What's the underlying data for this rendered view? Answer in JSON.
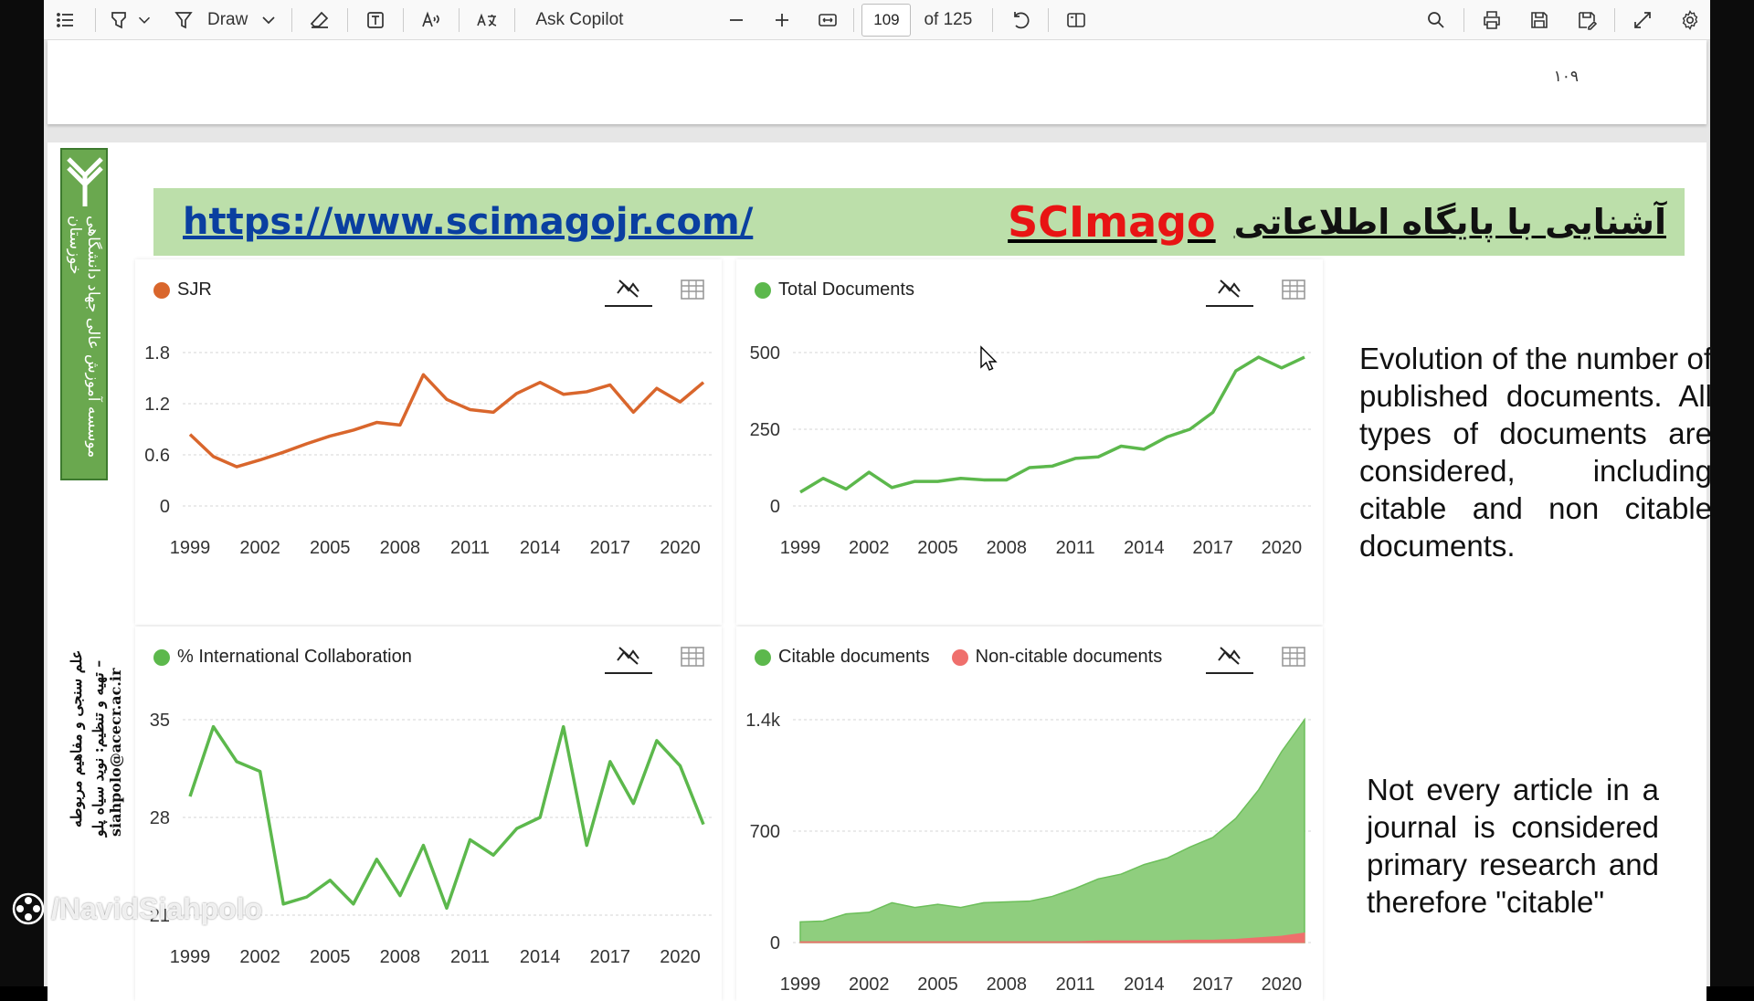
{
  "toolbar": {
    "draw_label": "Draw",
    "copilot_label": "Ask Copilot",
    "page_current": "109",
    "page_total": "of 125"
  },
  "prev_page": {
    "page_number": "۱۰۹"
  },
  "slide": {
    "banner": {
      "url": "https://www.scimagojr.com/",
      "brand": "SCImago",
      "persian_title": "آشنایی با پایگاه اطلاعاتی"
    },
    "side_strip_text": "موسسه آموزش عالی جهاد دانشگاهی خوزستان",
    "side_text_1": "علم سنجی و مفاهیم مربوطه",
    "side_text_2": "تهیه و تنظیم: نوید سیاه پلو – siahpolo@acecr.ac.ir",
    "desc_1": "Evolution of the number of published documents. All types of documents are considered, including citable and non citable documents.",
    "desc_2": "Not every article in a journal is considered primary research and therefore \"citable\""
  },
  "watermark": "/NavidSiahpolo",
  "icons": [
    "list-icon",
    "highlighter-icon",
    "draw-icon",
    "eraser-icon",
    "text-box-icon",
    "read-aloud-icon",
    "translate-icon",
    "zoom-out-icon",
    "zoom-in-icon",
    "fit-page-icon",
    "rotate-icon",
    "page-view-icon",
    "search-icon",
    "print-icon",
    "save-icon",
    "save-as-icon",
    "fullscreen-icon",
    "settings-icon"
  ],
  "colors": {
    "sjr": "#d9662c",
    "green": "#5cb84c",
    "area_green": "#8fce7e",
    "noncitable": "#ef6f6c",
    "banner_bg": "#bcdfaa",
    "brand_red": "#e81414"
  },
  "chart_data": [
    {
      "type": "line",
      "title": "SJR",
      "x": [
        1999,
        2000,
        2001,
        2002,
        2003,
        2004,
        2005,
        2006,
        2007,
        2008,
        2009,
        2010,
        2011,
        2012,
        2013,
        2014,
        2015,
        2016,
        2017,
        2018,
        2019,
        2020,
        2021
      ],
      "series": [
        {
          "name": "SJR",
          "values": [
            0.84,
            0.58,
            0.46,
            0.54,
            0.63,
            0.73,
            0.82,
            0.89,
            0.98,
            0.95,
            1.54,
            1.25,
            1.13,
            1.1,
            1.32,
            1.45,
            1.31,
            1.34,
            1.42,
            1.1,
            1.38,
            1.22,
            1.45,
            1.43
          ]
        }
      ],
      "yticks": [
        "0",
        "0.6",
        "1.2",
        "1.8"
      ],
      "ylim": [
        0,
        1.8
      ],
      "xticks": [
        "1999",
        "2002",
        "2005",
        "2008",
        "2011",
        "2014",
        "2017",
        "2020"
      ],
      "grid": true
    },
    {
      "type": "line",
      "title": "Total Documents",
      "x": [
        1999,
        2000,
        2001,
        2002,
        2003,
        2004,
        2005,
        2006,
        2007,
        2008,
        2009,
        2010,
        2011,
        2012,
        2013,
        2014,
        2015,
        2016,
        2017,
        2018,
        2019,
        2020,
        2021
      ],
      "series": [
        {
          "name": "Total Documents",
          "values": [
            45,
            90,
            55,
            110,
            60,
            80,
            80,
            90,
            85,
            85,
            125,
            130,
            155,
            160,
            195,
            185,
            225,
            250,
            305,
            440,
            485,
            450,
            485
          ]
        }
      ],
      "yticks": [
        "0",
        "250",
        "500"
      ],
      "ylim": [
        0,
        500
      ],
      "xticks": [
        "1999",
        "2002",
        "2005",
        "2008",
        "2011",
        "2014",
        "2017",
        "2020"
      ],
      "grid": true
    },
    {
      "type": "line",
      "title": "% International Collaboration",
      "x": [
        1999,
        2000,
        2001,
        2002,
        2003,
        2004,
        2005,
        2006,
        2007,
        2008,
        2009,
        2010,
        2011,
        2012,
        2013,
        2014,
        2015,
        2016,
        2017,
        2018,
        2019,
        2020,
        2021
      ],
      "series": [
        {
          "name": "% International Collaboration",
          "values": [
            29.5,
            34.5,
            32,
            31.3,
            21.8,
            22.3,
            23.5,
            21.8,
            25,
            22.4,
            26,
            21.5,
            26.4,
            25.3,
            27.2,
            28,
            34.5,
            26,
            32,
            29,
            33.5,
            31.7,
            27.5
          ]
        }
      ],
      "yticks": [
        "21",
        "28",
        "35"
      ],
      "ylim": [
        21,
        35
      ],
      "xticks": [
        "1999",
        "2002",
        "2005",
        "2008",
        "2011",
        "2014",
        "2017",
        "2020"
      ],
      "grid": true
    },
    {
      "type": "area",
      "title": "",
      "x": [
        1999,
        2000,
        2001,
        2002,
        2003,
        2004,
        2005,
        2006,
        2007,
        2008,
        2009,
        2010,
        2011,
        2012,
        2013,
        2014,
        2015,
        2016,
        2017,
        2018,
        2019,
        2020,
        2021
      ],
      "series": [
        {
          "name": "Citable documents",
          "values": [
            130,
            135,
            180,
            190,
            250,
            220,
            240,
            220,
            250,
            255,
            260,
            290,
            340,
            400,
            430,
            490,
            530,
            600,
            660,
            780,
            960,
            1200,
            1400
          ]
        },
        {
          "name": "Non-citable documents",
          "values": [
            5,
            5,
            5,
            5,
            5,
            5,
            5,
            5,
            5,
            5,
            5,
            5,
            5,
            10,
            10,
            10,
            10,
            15,
            15,
            20,
            30,
            40,
            60
          ]
        }
      ],
      "yticks": [
        "0",
        "700",
        "1.4k"
      ],
      "ylim": [
        0,
        1400
      ],
      "xticks": [
        "1999",
        "2002",
        "2005",
        "2008",
        "2011",
        "2014",
        "2017",
        "2020"
      ],
      "grid": true,
      "stacked": true
    }
  ]
}
